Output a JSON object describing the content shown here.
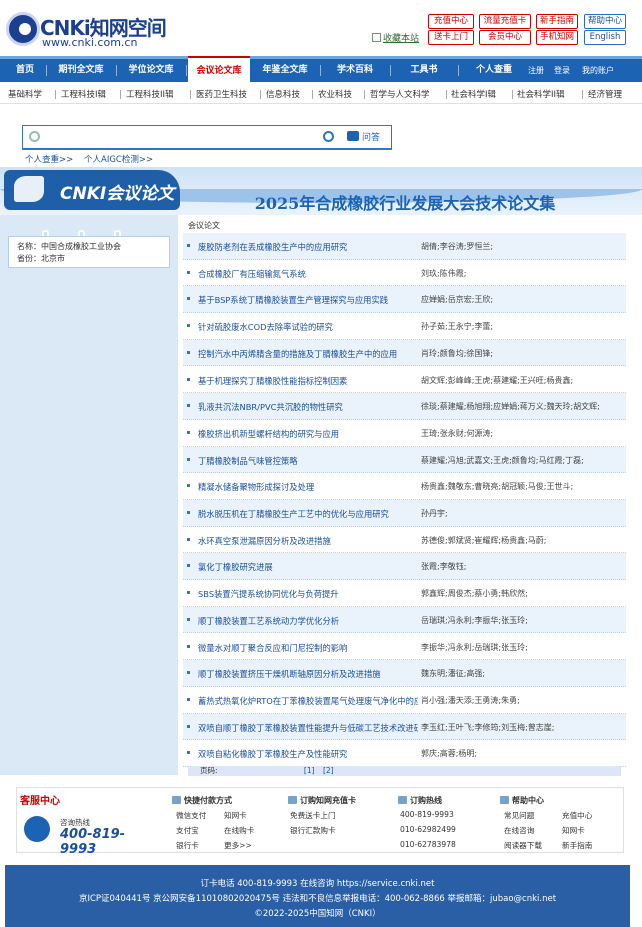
{
  "header": {
    "logo_brand": "CNKi知网空间",
    "logo_url": "www.cnki.com.cn",
    "favorite": "收藏本站",
    "buttons_red": [
      "充值中心",
      "流量充值卡",
      "新手指南",
      "送卡上门",
      "会员中心",
      "手机知网"
    ],
    "buttons_blue": [
      "帮助中心",
      "English"
    ]
  },
  "nav": {
    "items": [
      "首页",
      "期刊全文库",
      "学位论文库",
      "会议论文库",
      "年鉴全文库",
      "学术百科",
      "工具书",
      "个人查重"
    ],
    "active_index": 3,
    "right_links": [
      "注册",
      "登录",
      "我的账户"
    ]
  },
  "subnav": {
    "items": [
      "基础科学",
      "工程科技I辑",
      "工程科技II辑",
      "医药卫生科技",
      "信息科技",
      "农业科技",
      "哲学与人文科学",
      "社会科学I辑",
      "社会科学II辑",
      "经济管理"
    ]
  },
  "search": {
    "qa_label": "问答",
    "links": [
      "个人查重>>",
      "个人AIGC检测>>"
    ]
  },
  "banner": {
    "logo_text": "CNKI会议论文"
  },
  "page": {
    "title": "2025年合成橡胶行业发展大会技术论文集",
    "crumb": "会议论文"
  },
  "sidebar": {
    "name_label": "名称：",
    "name_value": "中国合成橡胶工业协会",
    "province_label": "省份：",
    "province_value": "北京市"
  },
  "papers": [
    {
      "title": "废胶防老剂在丢成橡胶生产中的应用研究",
      "authors": "胡倩;李谷涛;罗恒兰;"
    },
    {
      "title": "合成橡胶厂有压缩输氮气系统",
      "authors": "刘玖;陈伟霞;"
    },
    {
      "title": "基于BSP系统丁腈橡胶装置生产管理探究与应用实践",
      "authors": "应婵娟;岳京宏;王欣;"
    },
    {
      "title": "针对硫胶废水COD去除率试验的研究",
      "authors": "孙子茹;王永宁;李蕾;"
    },
    {
      "title": "控制汽水中丙烯腈含量的措施及丁腈橡胶生产中的应用",
      "authors": "肖玲;颜鲁均;徐国锋;"
    },
    {
      "title": "基于机理探究丁腈橡胶性能指标控制因素",
      "authors": "胡文辉;彭峰峰;王虎;蔡建耀;王兴旺;杨贵鑫;"
    },
    {
      "title": "乳液共沉法NBR/PVC共沉胶的物性研究",
      "authors": "徐琰;蔡建耀;杨旭翔;应婵娟;蒋万义;魏天玲;胡文辉;"
    },
    {
      "title": "橡胶挤出机新型螺杆结构的研究与应用",
      "authors": "王琦;张永财;何源涛;"
    },
    {
      "title": "丁腈橡胶制品气味管控策略",
      "authors": "蔡建耀;冯旭;武嘉文;王虎;颜鲁均;马红霞;丁磊;"
    },
    {
      "title": "精凝水储备聚物形成探讨及处理",
      "authors": "杨贵鑫;魏敬东;曹晓亮;胡冠颖;马俊;王世斗;"
    },
    {
      "title": "脱水脱压机在丁腈橡胶生产工艺中的优化与应用研究",
      "authors": "孙丹宇;"
    },
    {
      "title": "水环真空泵泄漏原因分析及改进措施",
      "authors": "苏德俊;郭斌贤;崔耀辉;杨贵鑫;马蔚;"
    },
    {
      "title": "氯化丁橡胶研究进展",
      "authors": "张霞;李敬钰;"
    },
    {
      "title": "SBS装置汽提系统协同优化与负荷提升",
      "authors": "郭鑫辉;周俊杰;蔡小勇;韩欣然;"
    },
    {
      "title": "顺丁橡胶装置工艺系统动力学优化分析",
      "authors": "岳瑞琪;冯永利;李振华;张玉玲;"
    },
    {
      "title": "微量水对顺丁聚合反应和门尼控制的影响",
      "authors": "李振华;冯永利;岳瑞琪;张玉玲;"
    },
    {
      "title": "顺丁橡胶装置挤压干燥机断轴原因分析及改进措施",
      "authors": "魏东明;潘征;高强;"
    },
    {
      "title": "蓄热式热氧化炉RTO在丁苯橡胶装置尾气处理废气净化中的应用",
      "authors": "肖小强;潘天添;王勇涛;朱勇;"
    },
    {
      "title": "双喷自顺丁橡胶丁苯橡胶装置性能提升与低碳工艺技术改进研究",
      "authors": "李玉红;王叶飞;李修筠;刘玉梅;曾志崖;"
    },
    {
      "title": "双喷自粘化橡胶丁苯橡胶生产及性能研究",
      "authors": "郭庆;高蓉;杨明;"
    }
  ],
  "pager": {
    "label": "页码:",
    "pages": [
      "[1]",
      "[2]"
    ]
  },
  "footer": {
    "cs_title": "客服中心",
    "cs_label": "咨询热线",
    "cs_number": "400-819-9993",
    "col1_title": "快捷付款方式",
    "col1_items": [
      "微信支付",
      "知网卡",
      "支付宝",
      "在线购卡",
      "银行卡",
      "更多>>"
    ],
    "col2_title": "订购知网充值卡",
    "col2_items": [
      "免费送卡上门",
      "银行汇款购卡"
    ],
    "col3_title": "订购热线",
    "col3_items": [
      "400-819-9993",
      "010-62982499",
      "010-62783978"
    ],
    "col4_title": "帮助中心",
    "col4_items": [
      "常见问题",
      "充值中心",
      "在线咨询",
      "知网卡",
      "阅读器下载",
      "新手指南"
    ]
  },
  "bottom": {
    "line1": "订卡电话 400-819-9993      在线咨询 https://service.cnki.net",
    "line2": "京ICP证040441号   京公网安备11010802020475号   违法和不良信息举报电话：400-062-8866   举报邮箱：jubao@cnki.net",
    "line3": "©2022-2025中国知网（CNKI）"
  }
}
